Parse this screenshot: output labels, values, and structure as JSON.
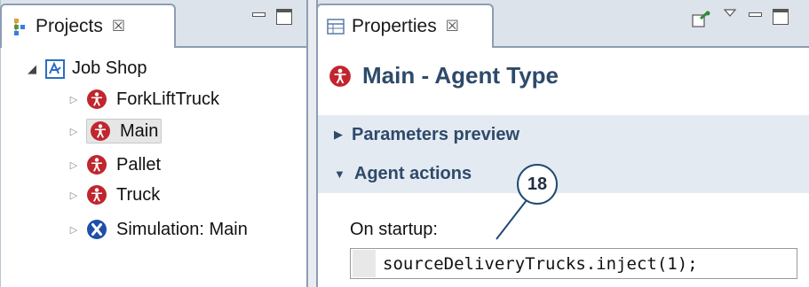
{
  "projects": {
    "tab_title": "Projects",
    "tab_close": "☒",
    "tree": {
      "root": "Job Shop",
      "items": [
        {
          "label": "ForkLiftTruck",
          "icon": "agent-icon"
        },
        {
          "label": "Main",
          "icon": "agent-icon",
          "selected": true
        },
        {
          "label": "Pallet",
          "icon": "agent-icon"
        },
        {
          "label": "Truck",
          "icon": "agent-icon"
        },
        {
          "label": "Simulation: Main",
          "icon": "simulation-icon"
        }
      ]
    }
  },
  "properties": {
    "tab_title": "Properties",
    "tab_close": "☒",
    "title": "Main - Agent Type",
    "sections": {
      "parameters_preview": "Parameters preview",
      "agent_actions": "Agent actions"
    },
    "on_startup_label": "On startup:",
    "on_startup_code": "sourceDeliveryTrucks.inject(1);"
  },
  "callout": {
    "number": "18"
  },
  "colors": {
    "agent_red": "#c0262e",
    "sim_blue": "#1f4fa8",
    "heading": "#2e4a6b",
    "tab_border": "#8e9db2"
  }
}
